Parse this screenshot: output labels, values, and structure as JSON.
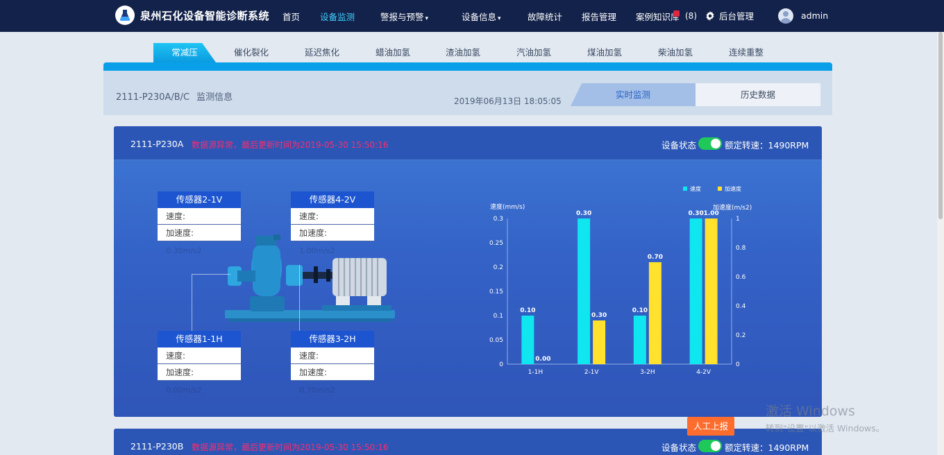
{
  "app": {
    "title": "泉州石化设备智能诊断系统"
  },
  "nav": {
    "home": "首页",
    "monitor": "设备监测",
    "alarm": "警报与预警",
    "device_info": "设备信息",
    "fault_stats": "故障统计",
    "report_mgmt": "报告管理",
    "case_kb": "案例知识库",
    "case_kb_count": "(8)",
    "admin_mgmt": "后台管理",
    "username": "admin"
  },
  "categories": [
    "常减压",
    "催化裂化",
    "延迟焦化",
    "蜡油加氢",
    "渣油加氢",
    "汽油加氢",
    "煤油加氢",
    "柴油加氢",
    "连续重整"
  ],
  "monitor_header": {
    "unit_id": "2111-P230A/B/C",
    "label": "监测信息",
    "datetime": "2019年06月13日 18:05:05",
    "tab_realtime": "实时监测",
    "tab_history": "历史数据"
  },
  "devices": [
    {
      "id": "2111-P230A",
      "alert": "数据源异常，最后更新时间为2019-05-30 15:50:16",
      "status_label": "设备状态",
      "rated_speed": "额定转速：1490RPM"
    },
    {
      "id": "2111-P230B",
      "alert": "数据源异常，最后更新时间为2019-05-30 15:50:16",
      "status_label": "设备状态",
      "rated_speed": "额定转速：1490RPM"
    }
  ],
  "sensors": {
    "s1": {
      "title": "传感器2-1V",
      "speed_label": "速度:",
      "accel_label": "加速度:",
      "ghost": "0.30m/s2"
    },
    "s2": {
      "title": "传感器4-2V",
      "speed_label": "速度:",
      "accel_label": "加速度:",
      "ghost": "1.00m/s2"
    },
    "s3": {
      "title": "传感器1-1H",
      "speed_label": "速度:",
      "accel_label": "加速度:",
      "ghost": "0.00m/s2"
    },
    "s4": {
      "title": "传感器3-2H",
      "speed_label": "速度:",
      "accel_label": "加速度:",
      "ghost": "0.70m/s2"
    }
  },
  "chart_data": {
    "type": "bar",
    "categories": [
      "1-1H",
      "2-1V",
      "3-2H",
      "4-2V"
    ],
    "series": [
      {
        "name": "速度",
        "values": [
          0.1,
          0.3,
          0.1,
          0.3
        ],
        "color": "#0fe6f0",
        "axis": "left"
      },
      {
        "name": "加速度",
        "values": [
          0.0,
          0.3,
          0.7,
          1.0
        ],
        "color": "#ffe12e",
        "axis": "right"
      }
    ],
    "ylabel_left": "速度(mm/s)",
    "ylabel_right": "加速度(m/s2)",
    "ylim_left": [
      0,
      0.3
    ],
    "ylim_right": [
      0,
      1
    ],
    "yticks_left": [
      "0",
      "0.05",
      "0.1",
      "0.15",
      "0.2",
      "0.25",
      "0.3"
    ],
    "yticks_right": [
      "0",
      "0.2",
      "0.4",
      "0.6",
      "0.8",
      "1"
    ],
    "legend_position": "top-right",
    "grid": false
  },
  "actions": {
    "manual_report": "人工上报"
  },
  "watermark": {
    "line1": "激活 Windows",
    "line2": "转到\"设置\"以激活 Windows。"
  },
  "colors": {
    "accent": "#0aa0e9",
    "nav_bg": "#13224a",
    "alert": "#ff2a6d",
    "status_on": "#1ec95a",
    "report_btn": "#ff6d2e"
  }
}
